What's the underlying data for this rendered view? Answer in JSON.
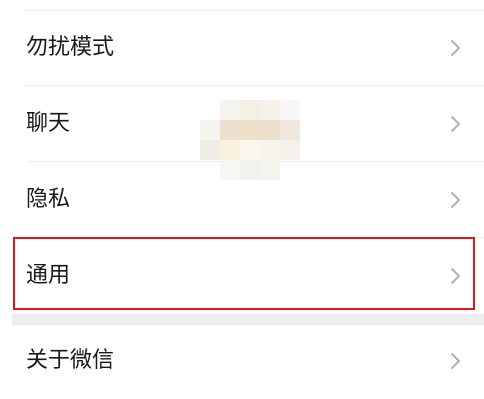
{
  "settings": {
    "items": [
      {
        "label": "勿扰模式"
      },
      {
        "label": "聊天"
      },
      {
        "label": "隐私"
      },
      {
        "label": "通用"
      },
      {
        "label": "关于微信"
      }
    ]
  },
  "highlight": {
    "color": "#e0191f",
    "target": "通用"
  },
  "icons": {
    "chevron": "chevron-right-icon"
  }
}
